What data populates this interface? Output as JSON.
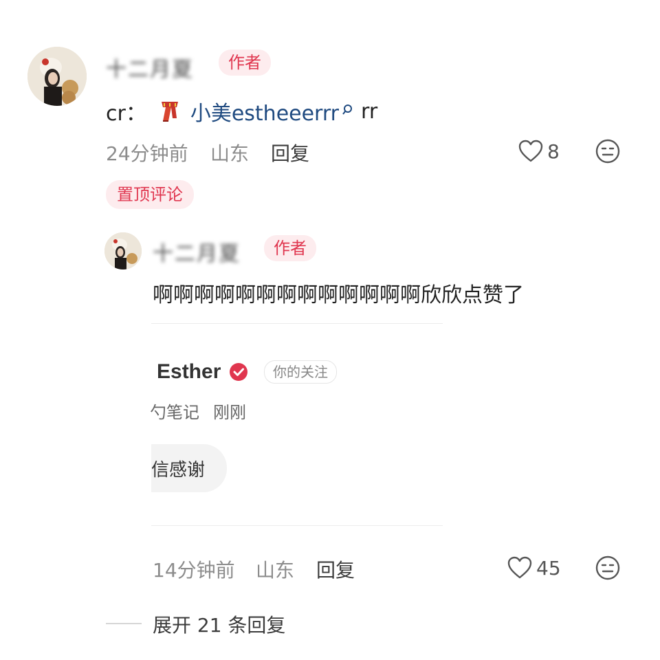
{
  "comment": {
    "username": "十二月夏",
    "author_badge": "作者",
    "text_prefix": "cr：",
    "mention": "小美estheeerrr",
    "text_suffix": "rr",
    "time": "24分钟前",
    "location": "山东",
    "reply_label": "回复",
    "like_count": "8",
    "pinned_label": "置顶评论"
  },
  "reply": {
    "username": "十二月夏",
    "author_badge": "作者",
    "text": "啊啊啊啊啊啊啊啊啊啊啊啊啊欣欣点赞了",
    "quote": {
      "name": "Esther",
      "follow_badge": "你的关注",
      "note_fragment": "勺笔记",
      "time": "刚刚",
      "message": "信感谢"
    },
    "time": "14分钟前",
    "location": "山东",
    "reply_label": "回复",
    "like_count": "45"
  },
  "expand_label": "展开 21 条回复",
  "colors": {
    "accent": "#e0364f",
    "link": "#1f4a80",
    "meta": "#8c8c8c"
  },
  "icons": [
    "heart-icon",
    "sticker-icon",
    "search-icon",
    "verified-icon",
    "scarf-icon"
  ]
}
